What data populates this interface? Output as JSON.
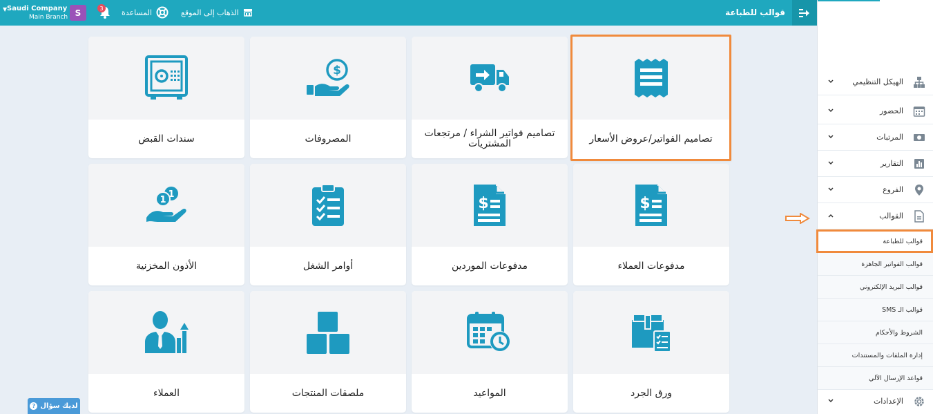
{
  "topbar": {
    "page_title": "قوالب للطباعة",
    "goto_site": "الذهاب إلى الموقع",
    "help": "المساعدة",
    "notifications_count": "3",
    "avatar_letter": "S",
    "company": "Saudi Company",
    "branch": "Main Branch"
  },
  "sidebar": {
    "items": [
      {
        "label": "الهيكل التنظيمي",
        "icon": "org-chart-icon"
      },
      {
        "label": "الحضور",
        "icon": "calendar-icon"
      },
      {
        "label": "المرتبات",
        "icon": "money-icon"
      },
      {
        "label": "التقارير",
        "icon": "bar-chart-icon"
      },
      {
        "label": "الفروع",
        "icon": "location-pin-icon"
      },
      {
        "label": "القوالب",
        "icon": "document-icon"
      }
    ],
    "sub_items": [
      "قوالب للطباعة",
      "قوالب الفواتير الجاهزة",
      "قوالب البريد الإلكتروني",
      "قوالب الـ SMS",
      "الشروط والأحكام",
      "إدارة الملفات والمستندات",
      "قواعد الإرسال الآلي"
    ],
    "settings": {
      "label": "الإعدادات",
      "icon": "gear-icon"
    }
  },
  "cards": [
    {
      "label": "تصاميم الفواتير/عروض الأسعار",
      "icon": "invoice-receipt-icon"
    },
    {
      "label": "تصاميم فواتير الشراء / مرتجعات المشتريات",
      "icon": "delivery-truck-icon"
    },
    {
      "label": "المصروفات",
      "icon": "hand-coin-icon"
    },
    {
      "label": "سندات القبض",
      "icon": "safe-icon"
    },
    {
      "label": "مدفوعات العملاء",
      "icon": "dollar-document-icon"
    },
    {
      "label": "مدفوعات الموردين",
      "icon": "dollar-document-icon"
    },
    {
      "label": "أوامر الشغل",
      "icon": "checklist-clipboard-icon"
    },
    {
      "label": "الأذون المخزنية",
      "icon": "hand-coins-icon"
    },
    {
      "label": "ورق الجرد",
      "icon": "inventory-box-icon"
    },
    {
      "label": "المواعيد",
      "icon": "calendar-clock-icon"
    },
    {
      "label": "ملصقات المنتجات",
      "icon": "stacked-boxes-icon"
    },
    {
      "label": "العملاء",
      "icon": "person-growth-icon"
    }
  ],
  "help_button": "لديك سؤال",
  "colors": {
    "accent": "#1fa8bf",
    "icon": "#1e9ac0",
    "highlight": "#f08a3c"
  }
}
